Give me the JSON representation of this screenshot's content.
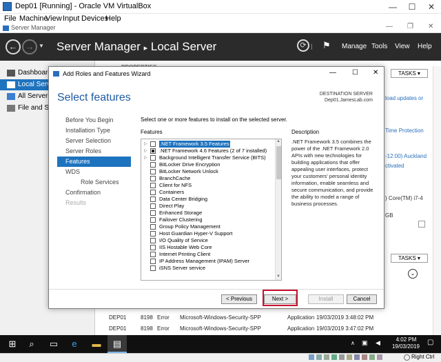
{
  "vbox": {
    "title": "Dep01 [Running] - Oracle VM VirtualBox",
    "menu": [
      "File",
      "Machine",
      "View",
      "Input",
      "Devices",
      "Help"
    ],
    "hostkey": "Right Ctrl"
  },
  "server_manager": {
    "window_title": "Server Manager",
    "breadcrumb_app": "Server Manager",
    "breadcrumb_separator": "▸",
    "breadcrumb_page": "Local Server",
    "menu": [
      "Manage",
      "Tools",
      "View",
      "Help"
    ],
    "sidebar": [
      {
        "label": "Dashboard",
        "active": false
      },
      {
        "label": "Local Server",
        "active": true
      },
      {
        "label": "All Servers",
        "active": false
      },
      {
        "label": "File and Sto",
        "active": false
      }
    ],
    "properties_label": "PROPERTIES",
    "tasks_label": "TASKS",
    "bg_snippets": {
      "updates": "load updates or",
      "protection": "Time Protection",
      "timezone": "-12:00) Auckland",
      "activated": "ctivated",
      "cpu": ") Core(TM) i7-4",
      "ram": "GB"
    },
    "events": [
      {
        "server": "DEP01",
        "id": "8198",
        "severity": "Error",
        "source": "Microsoft-Windows-Security-SPP",
        "log": "Application",
        "date": "19/03/2019 3:48:02 PM"
      },
      {
        "server": "DEP01",
        "id": "8198",
        "severity": "Error",
        "source": "Microsoft-Windows-Security-SPP",
        "log": "Application",
        "date": "19/03/2019 3:47:02 PM"
      }
    ]
  },
  "wizard": {
    "title": "Add Roles and Features Wizard",
    "heading": "Select features",
    "destination_label": "DESTINATION SERVER",
    "destination_value": "Dep01.JamesLab.com",
    "steps": [
      {
        "label": "Before You Begin",
        "state": "normal"
      },
      {
        "label": "Installation Type",
        "state": "normal"
      },
      {
        "label": "Server Selection",
        "state": "normal"
      },
      {
        "label": "Server Roles",
        "state": "normal"
      },
      {
        "label": "Features",
        "state": "active"
      },
      {
        "label": "WDS",
        "state": "normal"
      },
      {
        "label": "Role Services",
        "state": "sub"
      },
      {
        "label": "Confirmation",
        "state": "normal"
      },
      {
        "label": "Results",
        "state": "disabled"
      }
    ],
    "instruction": "Select one or more features to install on the selected server.",
    "features_label": "Features",
    "description_label": "Description",
    "features": [
      {
        "label": ".NET Framework 3.5 Features",
        "expandable": true,
        "check": "none",
        "selected": true
      },
      {
        "label": ".NET Framework 4.6 Features (2 of 7 installed)",
        "expandable": true,
        "check": "partial",
        "selected": false
      },
      {
        "label": "Background Intelligent Transfer Service (BITS)",
        "expandable": true,
        "check": "none",
        "selected": false
      },
      {
        "label": "BitLocker Drive Encryption",
        "expandable": false,
        "check": "none",
        "selected": false
      },
      {
        "label": "BitLocker Network Unlock",
        "expandable": false,
        "check": "none",
        "selected": false
      },
      {
        "label": "BranchCache",
        "expandable": false,
        "check": "none",
        "selected": false
      },
      {
        "label": "Client for NFS",
        "expandable": false,
        "check": "none",
        "selected": false
      },
      {
        "label": "Containers",
        "expandable": false,
        "check": "none",
        "selected": false
      },
      {
        "label": "Data Center Bridging",
        "expandable": false,
        "check": "none",
        "selected": false
      },
      {
        "label": "Direct Play",
        "expandable": false,
        "check": "none",
        "selected": false
      },
      {
        "label": "Enhanced Storage",
        "expandable": false,
        "check": "none",
        "selected": false
      },
      {
        "label": "Failover Clustering",
        "expandable": false,
        "check": "none",
        "selected": false
      },
      {
        "label": "Group Policy Management",
        "expandable": false,
        "check": "none",
        "selected": false
      },
      {
        "label": "Host Guardian Hyper-V Support",
        "expandable": false,
        "check": "none",
        "selected": false
      },
      {
        "label": "I/O Quality of Service",
        "expandable": false,
        "check": "none",
        "selected": false
      },
      {
        "label": "IIS Hostable Web Core",
        "expandable": false,
        "check": "none",
        "selected": false
      },
      {
        "label": "Internet Printing Client",
        "expandable": false,
        "check": "none",
        "selected": false
      },
      {
        "label": "IP Address Management (IPAM) Server",
        "expandable": false,
        "check": "none",
        "selected": false
      },
      {
        "label": "iSNS Server service",
        "expandable": false,
        "check": "none",
        "selected": false
      }
    ],
    "description": ".NET Framework 3.5 combines the power of the .NET Framework 2.0 APIs with new technologies for building applications that offer appealing user interfaces, protect your customers' personal identity information, enable seamless and secure communication, and provide the ability to model a range of business processes.",
    "buttons": {
      "previous": "< Previous",
      "next": "Next >",
      "install": "Install",
      "cancel": "Cancel"
    }
  },
  "taskbar": {
    "time": "4:02 PM",
    "date": "19/03/2019"
  }
}
